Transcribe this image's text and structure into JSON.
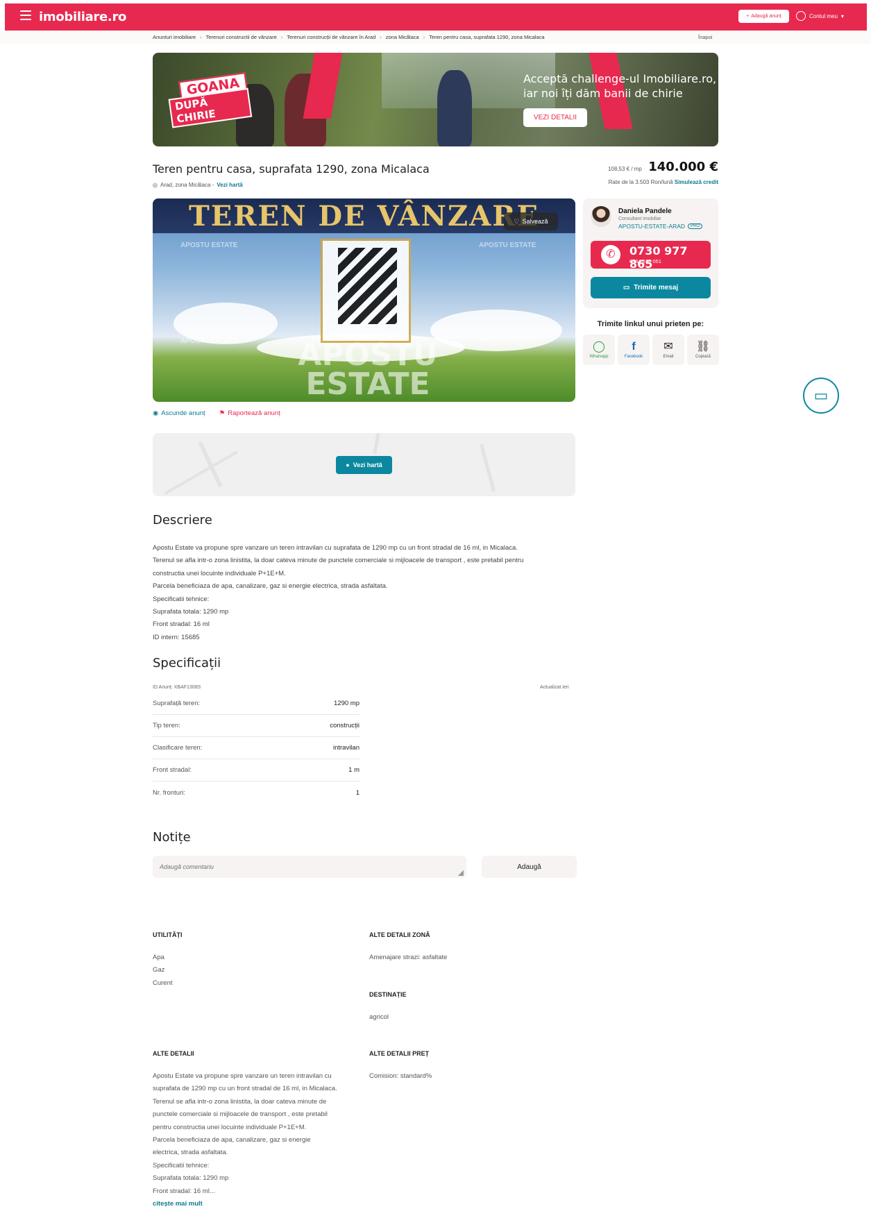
{
  "header": {
    "logo": "imobiliare.ro",
    "add_listing": "Adaugă anunț",
    "account": "Contul meu"
  },
  "breadcrumb": {
    "items": [
      "Anunturi imobiliare",
      "Terenuri constructii de vânzare",
      "Terenuri construcții de vânzare în Arad",
      "zona Micălaca",
      "Teren pentru casa, suprafata 1290, zona Micalaca"
    ],
    "back": "Înapoi"
  },
  "banner": {
    "badge_line1": "GOANA",
    "badge_line2": "DUPĂ CHIRIE",
    "text_line1": "Acceptă challenge-ul Imobiliare.ro,",
    "text_line2": "iar noi îți dăm banii de chirie",
    "button": "VEZI DETALII"
  },
  "listing": {
    "title": "Teren pentru casa, suprafata 1290, zona Micalaca",
    "location": "Arad, zona Micălaca -",
    "map_link": "Vezi hartă",
    "price_per_m2": "108,53 € / mp",
    "price": "140.000 €",
    "rate_prefix": "Rate de la 3.503 Ron/lună",
    "rate_link": "Simulează credit",
    "save": "Salvează",
    "photo_text": "TEREN DE VÂNZARE",
    "photo_logo": "APOSTU ESTATE",
    "photo_watermark_small": "APOSTU ESTATE",
    "hide": "Ascunde anunț",
    "report": "Raportează anunț",
    "map_button": "Vezi hartă"
  },
  "agent": {
    "name": "Daniela Pandele",
    "role": "Consultant imobiliar",
    "agency": "APOSTU-ESTATE-ARAD",
    "pro": "PRO",
    "phone": "0730 977 865",
    "phone2": "0764 510 051",
    "message": "Trimite mesaj"
  },
  "share": {
    "title": "Trimite linkul unui prieten pe:",
    "items": [
      "Whatsapp",
      "Facebook",
      "Email",
      "Copiază"
    ]
  },
  "description": {
    "heading": "Descriere",
    "lines": [
      "Apostu Estate va propune spre vanzare un teren intravilan cu suprafata de 1290 mp cu un front stradal de 16 ml, in Micalaca.",
      "Terenul se afla intr-o zona linistita, la doar cateva minute de punctele comerciale si mijloacele de transport , este pretabil pentru",
      "constructia unei locuinte individuale P+1E+M.",
      "Parcela beneficiaza de apa, canalizare, gaz si energie electrica, strada asfaltata.",
      "Specificatii tehnice:",
      "Suprafata totala: 1290 mp",
      "Front stradal: 16 ml",
      "ID intern: 15685"
    ]
  },
  "specs": {
    "heading": "Specificații",
    "id": "ID Anunț: XBAF1308S",
    "updated": "Actualizat ieri",
    "rows": [
      {
        "k": "Suprafață teren:",
        "v": "1290 mp"
      },
      {
        "k": "Tip teren:",
        "v": "construcții"
      },
      {
        "k": "Clasificare teren:",
        "v": "intravilan"
      },
      {
        "k": "Front stradal:",
        "v": "1 m"
      },
      {
        "k": "Nr. fronturi:",
        "v": "1"
      }
    ]
  },
  "notes": {
    "heading": "Notițe",
    "placeholder": "Adaugă comentariu",
    "add": "Adaugă"
  },
  "details": {
    "utilities_h": "UTILITĂȚI",
    "utilities": [
      "Apa",
      "Gaz",
      "Curent"
    ],
    "zone_h": "ALTE DETALII ZONĂ",
    "zone": [
      "Amenajare strazi: asfaltate"
    ],
    "destination_h": "DESTINAȚIE",
    "destination": [
      "agricol"
    ],
    "other_h": "ALTE DETALII",
    "other": [
      "Apostu Estate va propune spre vanzare un teren intravilan cu",
      "suprafata de 1290 mp cu un front stradal de 16 ml, in Micalaca.",
      "Terenul se afla intr-o zona linistita, la doar cateva minute de",
      "punctele comerciale si mijloacele de transport , este pretabil",
      "pentru constructia unei locuinte individuale P+1E+M.",
      "Parcela beneficiaza de apa, canalizare, gaz si energie",
      "electrica, strada asfaltata.",
      "Specificatii tehnice:",
      "Suprafata totala: 1290 mp",
      "Front stradal: 16 ml..."
    ],
    "read_more": "citește mai mult",
    "price_h": "ALTE DETALII PREȚ",
    "price": [
      "Comision: standard%"
    ]
  }
}
